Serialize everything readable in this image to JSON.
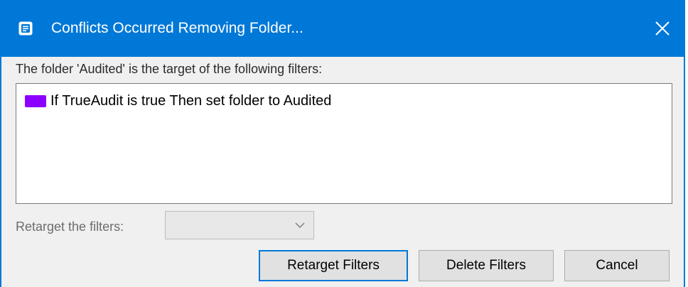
{
  "dialog": {
    "title": "Conflicts Occurred Removing Folder...",
    "prompt": "The folder 'Audited' is the target of the following filters:",
    "filters": [
      {
        "label": "If TrueAudit is true Then set folder to Audited",
        "color": "#8b00ff"
      }
    ],
    "retarget": {
      "label": "Retarget the filters:",
      "selected_value": ""
    },
    "buttons": {
      "retarget": "Retarget Filters",
      "delete": "Delete Filters",
      "cancel": "Cancel"
    }
  },
  "colors": {
    "title_bar": "#0078d7",
    "window_bg": "#f0f0f0",
    "filter_color": "#8b00ff"
  },
  "icons": {
    "app": "app-icon",
    "close": "close-icon",
    "dropdown": "chevron-down-icon"
  }
}
